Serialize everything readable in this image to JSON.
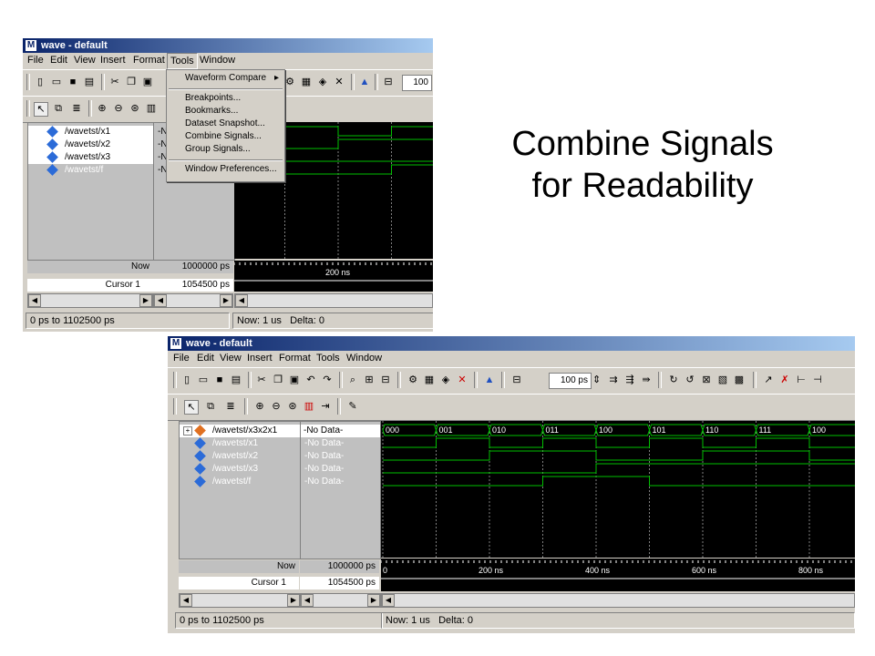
{
  "slide": {
    "title_line1": "Combine Signals",
    "title_line2": "for Readability"
  },
  "window1": {
    "title": "wave - default",
    "menu": [
      "File",
      "Edit",
      "View",
      "Insert",
      "Format",
      "Tools",
      "Window"
    ],
    "tools_menu": {
      "items": [
        {
          "label": "Waveform Compare",
          "submenu": true
        },
        {
          "label": "Breakpoints..."
        },
        {
          "label": "Bookmarks..."
        },
        {
          "label": "Dataset Snapshot..."
        },
        {
          "label": "Combine Signals..."
        },
        {
          "label": "Group Signals..."
        },
        {
          "label": "Window Preferences..."
        }
      ]
    },
    "zoom_partial": "100",
    "signals": [
      "/wavetst/x1",
      "/wavetst/x2",
      "/wavetst/x3",
      "/wavetst/f"
    ],
    "values_partial": [
      "-Nc",
      "-No",
      "-No",
      "-No"
    ],
    "now_label": "Now",
    "now_value": "1000000 ps",
    "cursor_label": "Cursor 1",
    "cursor_value": "1054500 ps",
    "timeline_label": "200 ns",
    "status_range": "0 ps to 1102500 ps",
    "status_now": "Now: 1 us",
    "status_delta": "Delta: 0"
  },
  "window2": {
    "title": "wave - default",
    "menu": [
      "File",
      "Edit",
      "View",
      "Insert",
      "Format",
      "Tools",
      "Window"
    ],
    "zoom": "100 ps",
    "signals": [
      {
        "name": "/wavetst/x3x2x1",
        "value": "-No Data-",
        "combined": true
      },
      {
        "name": "/wavetst/x1",
        "value": "-No Data-"
      },
      {
        "name": "/wavetst/x2",
        "value": "-No Data-"
      },
      {
        "name": "/wavetst/x3",
        "value": "-No Data-"
      },
      {
        "name": "/wavetst/f",
        "value": "-No Data-"
      }
    ],
    "bus_values": [
      "000",
      "001",
      "010",
      "011",
      "100",
      "101",
      "110",
      "111",
      "100"
    ],
    "now_label": "Now",
    "now_value": "1000000 ps",
    "cursor_label": "Cursor 1",
    "cursor_value": "1054500 ps",
    "timeline_labels": [
      "0",
      "200 ns",
      "400 ns",
      "600 ns",
      "800 ns"
    ],
    "status_range": "0 ps to 1102500 ps",
    "status_now": "Now: 1 us",
    "status_delta": "Delta: 0"
  },
  "colors": {
    "wave": "#00c000",
    "grid": "#808080",
    "titlebar": "#0a246a",
    "diamond": "#2b6bd8",
    "combined": "#e07020"
  },
  "icons": [
    "new-file-icon",
    "open-icon",
    "save-icon",
    "print-icon",
    "cut-icon",
    "copy-icon",
    "paste-icon",
    "undo-icon",
    "redo-icon",
    "find-icon",
    "pointer-icon",
    "zoom-in-icon",
    "zoom-out-icon",
    "up-arrow-icon"
  ]
}
